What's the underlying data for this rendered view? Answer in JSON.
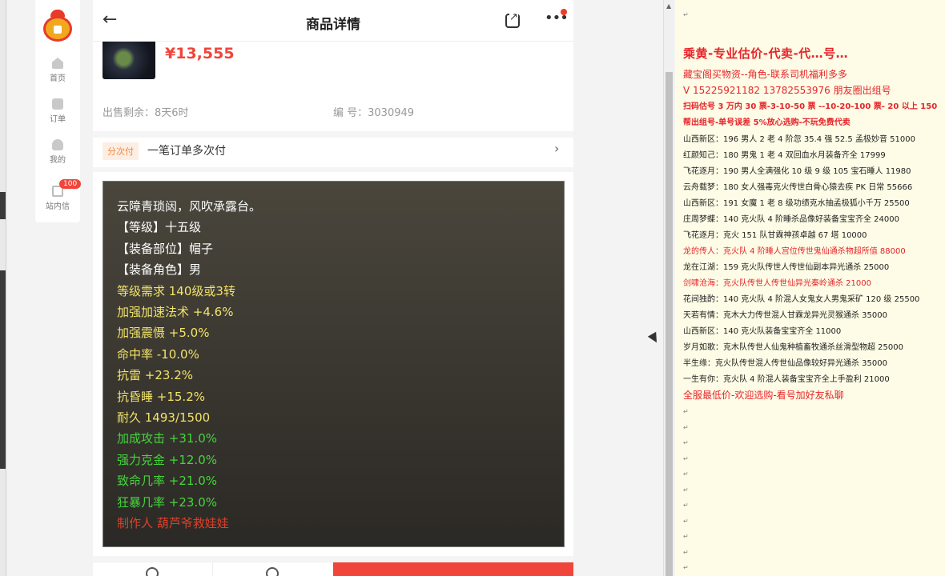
{
  "sidebar": {
    "items": [
      {
        "label": "首页",
        "icon": "home-icon"
      },
      {
        "label": "订单",
        "icon": "order-icon"
      },
      {
        "label": "我的",
        "icon": "user-icon"
      },
      {
        "label": "站内信",
        "icon": "mail-icon",
        "badge": "100"
      }
    ]
  },
  "header": {
    "title": "商品详情",
    "back": "←",
    "more": "•••"
  },
  "product": {
    "price": "¥13,555",
    "remaining_label": "出售剩余：",
    "remaining_value": "8天6时",
    "code_label": "编 号：",
    "code_value": "3030949"
  },
  "payment": {
    "tag": "分次付",
    "text": "一笔订单多次付",
    "chevron": "›"
  },
  "detail": {
    "lines": [
      {
        "text": "云障青琐闼，风吹承露台。",
        "color": "#ffffff"
      },
      {
        "text": "【等级】十五级",
        "color": "#ffffff"
      },
      {
        "text": "【装备部位】帽子",
        "color": "#ffffff"
      },
      {
        "text": "【装备角色】男",
        "color": "#ffffff"
      },
      {
        "text": "等级需求 140级或3转",
        "color": "#f2e36a"
      },
      {
        "text": "加强加速法术 +4.6%",
        "color": "#f2e36a"
      },
      {
        "text": "加强震慑 +5.0%",
        "color": "#f2e36a"
      },
      {
        "text": "命中率 -10.0%",
        "color": "#f2e36a"
      },
      {
        "text": "抗雷 +23.2%",
        "color": "#f2e36a"
      },
      {
        "text": "抗昏睡 +15.2%",
        "color": "#f2e36a"
      },
      {
        "text": "耐久 1493/1500",
        "color": "#f2e36a"
      },
      {
        "text": "加成攻击 +31.0%",
        "color": "#44d63c"
      },
      {
        "text": "强力克金 +12.0%",
        "color": "#44d63c"
      },
      {
        "text": "致命几率 +21.0%",
        "color": "#44d63c"
      },
      {
        "text": "狂暴几率 +23.0%",
        "color": "#44d63c"
      },
      {
        "text": "制作人 葫芦爷救娃娃",
        "color": "#e0402a"
      }
    ]
  },
  "notepad": {
    "lines": [
      {
        "text": "乘黄-专业估价-代卖-代…号…",
        "style": "big"
      },
      {
        "text": "藏宝阁买物资--角色-联系司机福利多多",
        "style": "mid"
      },
      {
        "text": "V 15225921182   13782553976 朋友圈出组号",
        "style": "mid"
      },
      {
        "text": "扫码估号 3 万内 30 票-3-10-50 票 --10-20-100 票- 20 以上 150",
        "style": "red bold"
      },
      {
        "text": "帮出组号-单号误差 5%放心选购-不玩免费代卖",
        "style": "red bold"
      },
      {
        "text": "山西新区：196 男人 2 老 4 阶忽 35.4 强 52.5 孟极妙音 51000",
        "style": ""
      },
      {
        "text": "红颜知己：180 男鬼 1 老 4 双回血水月装备齐全 17999",
        "style": ""
      },
      {
        "text": "飞花逐月：190 男人全满强化 10 级 9 级 105 宝石睡人 11980",
        "style": ""
      },
      {
        "text": "云舟载梦：180 女人强毒克火传世白骨心猿去疾 PK 日常 55666",
        "style": ""
      },
      {
        "text": "山西新区：191 女魔 1 老 8 级功绩克水抽孟极狐小千万 25500",
        "style": ""
      },
      {
        "text": "庄周梦蝶：140 克火队 4 阶睡杀品像好装备宝宝齐全 24000",
        "style": ""
      },
      {
        "text": "飞花逐月：克火 151 队甘霖神孩卓越 67 塔 10000",
        "style": ""
      },
      {
        "text": "龙的传人：克火队 4 阶睡人宫位传世鬼仙通杀物超所值 88000",
        "style": "red"
      },
      {
        "text": "龙在江湖：159 克火队传世人传世仙副本异光通杀 25000",
        "style": ""
      },
      {
        "text": "剑啸沧海：克火队传世人传世仙异光秦岭通杀 21000",
        "style": "red"
      },
      {
        "text": "花间独酌：140 克火队 4 阶混人女鬼女人男鬼采矿 120 级 25500",
        "style": ""
      },
      {
        "text": "天若有情：克木大力传世混人甘霖龙异光灵猴通杀 35000",
        "style": ""
      },
      {
        "text": "山西新区：140 克火队装备宝宝齐全 11000",
        "style": ""
      },
      {
        "text": "岁月如歌：克木队传世人仙鬼种植畜牧通杀丝滑型物超 25000",
        "style": ""
      },
      {
        "text": "半生缘：克火队传世混人传世仙品像较好异光通杀 35000",
        "style": ""
      },
      {
        "text": "一生有你：克火队 4 阶混人装备宝宝齐全上手盈利 21000",
        "style": ""
      },
      {
        "text": "全服最低价-欢迎选购-看号加好友私聊",
        "style": "mid"
      }
    ],
    "pilcrow": "↵"
  }
}
